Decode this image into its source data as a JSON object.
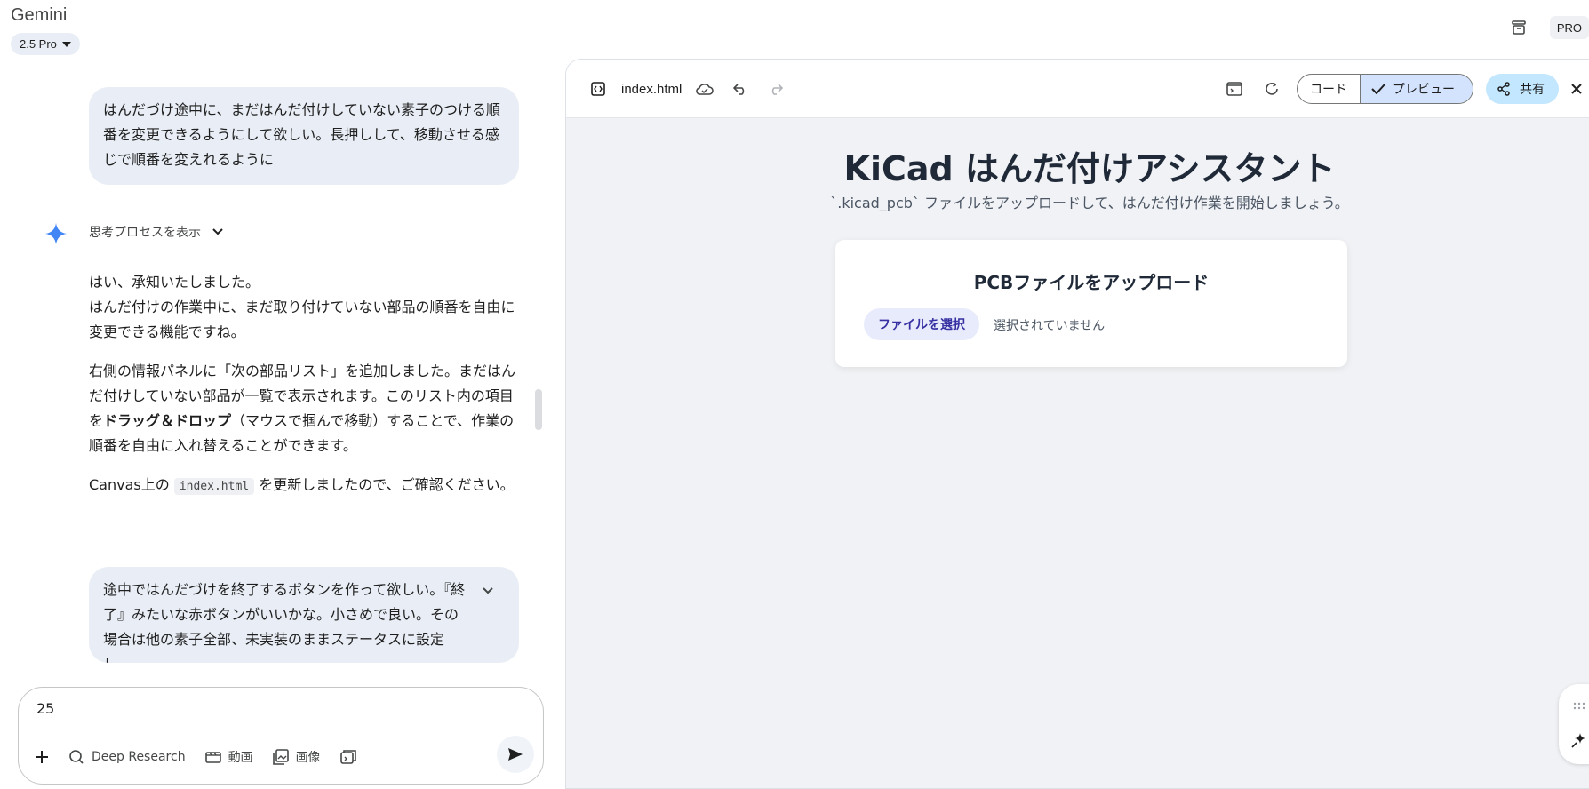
{
  "header": {
    "app_title": "Gemini",
    "model_label": "2.5 Pro",
    "pro_badge": "PRO"
  },
  "chat": {
    "user_message_1": "はんだづけ途中に、まだはんだ付けしていない素子のつける順番を変更できるようにして欲しい。長押しして、移動させる感じで順番を変えれるように",
    "thought_toggle": "思考プロセスを表示",
    "answer": {
      "p1_line1": "はい、承知いたしました。",
      "p1_line2": "はんだ付けの作業中に、まだ取り付けていない部品の順番を自由に変更できる機能ですね。",
      "p2_before": "右側の情報パネルに「次の部品リスト」を追加しました。まだはんだ付けしていない部品が一覧で表示されます。このリスト内の項目を",
      "p2_bold": "ドラッグ＆ドロップ",
      "p2_after": "（マウスで掴んで移動）することで、作業の順番を自由に入れ替えることができます。",
      "p3_before": "Canvas上の",
      "p3_code": "index.html",
      "p3_after": "を更新しましたので、ご確認ください。"
    },
    "user_message_2": "途中ではんだづけを終了するボタンを作って欲しい。『終了』みたいな赤ボタンがいいかな。小さめで良い。その場合は他の素子全部、未実装のままステータスに設定し..."
  },
  "input": {
    "value": "25",
    "tools": {
      "deep_research": "Deep Research",
      "video": "動画",
      "image": "画像"
    }
  },
  "canvas": {
    "file_name": "index.html",
    "code_tab": "コード",
    "preview_tab": "プレビュー",
    "share_label": "共有",
    "preview": {
      "title": "KiCad はんだ付けアシスタント",
      "subtitle": "`.kicad_pcb` ファイルをアップロードして、はんだ付け作業を開始しましょう。",
      "upload_title": "PCBファイルをアップロード",
      "file_button": "ファイルを選択",
      "file_status": "選択されていません"
    }
  },
  "colors": {
    "bubble_bg": "#e9eef6",
    "canvas_bg": "#f0f2f5",
    "preview_active": "#d3e3fd",
    "share_bg": "#c2e7ff",
    "file_button_bg": "#e8ebfb",
    "file_button_text": "#3730a3",
    "gemini_star": "#4285f4"
  }
}
